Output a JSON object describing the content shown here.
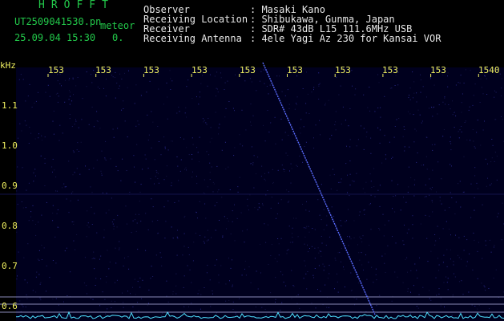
{
  "header": {
    "brand": "HROFFT",
    "filename": "UT2509041530.pn",
    "meteor_label": "meteor",
    "datetime": "25.09.04 15:30",
    "count": "0."
  },
  "info": {
    "labels": [
      "Observer",
      "Receiving Location",
      "Receiver",
      "Receiving Antenna"
    ],
    "values": [
      ": Masaki Kano",
      ": Shibukawa, Gunma, Japan",
      ": SDR# 43dB L15 111.6MHz USB",
      ": 4ele Yagi Az 230 for Kansai VOR"
    ]
  },
  "axes": {
    "y_unit": "kHz",
    "y_ticks": [
      "1.1",
      "1.0",
      "0.9",
      "0.8",
      "0.7",
      "0.6"
    ],
    "x_ticks": [
      "153",
      "153",
      "153",
      "153",
      "153",
      "153",
      "153",
      "153",
      "153",
      "1540"
    ]
  },
  "colors": {
    "title_green": "#22c84a",
    "tick_yellow": "#f0f060",
    "meteor_blue": "#5a6cff",
    "baseline_cyan": "#4fe0ff"
  }
}
